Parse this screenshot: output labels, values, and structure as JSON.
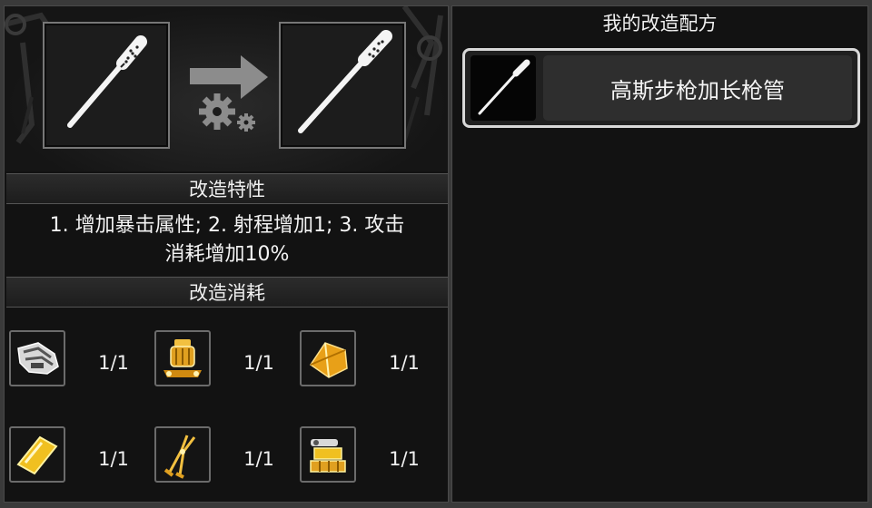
{
  "left_panel": {
    "source_item_icon": "rifle-barrel-icon",
    "result_item_icon": "long-rifle-barrel-icon",
    "transform_icon": "arrow-gears-icon",
    "traits_title": "改造特性",
    "traits_text_line1": "1. 增加暴击属性;  2. 射程增加1;  3. 攻击",
    "traits_text_line2": "消耗增加10%",
    "cost_title": "改造消耗",
    "materials": [
      {
        "icon": "gauntlet-part-icon",
        "count": "1/1"
      },
      {
        "icon": "brass-engine-part-icon",
        "count": "1/1"
      },
      {
        "icon": "gold-ore-icon",
        "count": "1/1"
      },
      {
        "icon": "gold-plate-icon",
        "count": "1/1"
      },
      {
        "icon": "pliers-icon",
        "count": "1/1"
      },
      {
        "icon": "gold-mechanism-icon",
        "count": "1/1"
      }
    ]
  },
  "right_panel": {
    "title": "我的改造配方",
    "recipes": [
      {
        "icon": "rifle-barrel-icon",
        "name": "高斯步枪加长枪管"
      }
    ]
  },
  "colors": {
    "panel_bg": "#121212",
    "frame": "#3a3a3a",
    "gold": "#e0a020",
    "text": "#f2f2f2"
  }
}
